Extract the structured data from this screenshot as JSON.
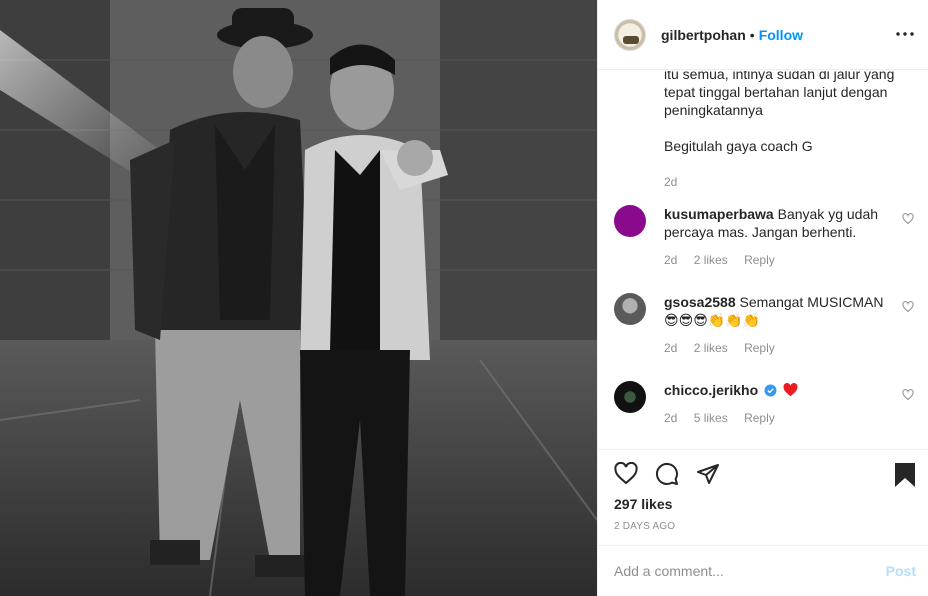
{
  "post": {
    "photo_alt": "photo"
  },
  "header": {
    "username": "gilbertpohan",
    "separator": "•",
    "follow_label": "Follow",
    "more_icon": "more-horizontal-icon"
  },
  "caption": {
    "line1": "itu semua, intinya sudah di jalur yang tepat tinggal bertahan lanjut dengan peningkatannya",
    "line2": "Begitulah gaya coach G",
    "time": "2d"
  },
  "comments": [
    {
      "username": "kusumaperbawa",
      "text": "Banyak yg udah percaya mas. Jangan berhenti.",
      "time": "2d",
      "likes": "2 likes",
      "reply": "Reply",
      "avatar_color": "#8a0a8e"
    },
    {
      "username": "gsosa2588",
      "text": "Semangat MUSICMAN",
      "emoji": "😎😎😎👏👏👏",
      "time": "2d",
      "likes": "2 likes",
      "reply": "Reply",
      "avatar_color": "#7a7a7a"
    },
    {
      "username": "chicco.jerikho",
      "text": "",
      "emoji": "❤️",
      "time": "2d",
      "likes": "5 likes",
      "reply": "Reply",
      "avatar_color": "#1d2b1f",
      "verified": true
    }
  ],
  "actions": {
    "likes": "297 likes",
    "date": "2 DAYS AGO"
  },
  "add_comment": {
    "placeholder": "Add a comment...",
    "post_label": "Post"
  },
  "colors": {
    "accent": "#0095f6",
    "verified": "#3897f0",
    "muted": "#8e8e8e",
    "heart": "#ed4956"
  }
}
